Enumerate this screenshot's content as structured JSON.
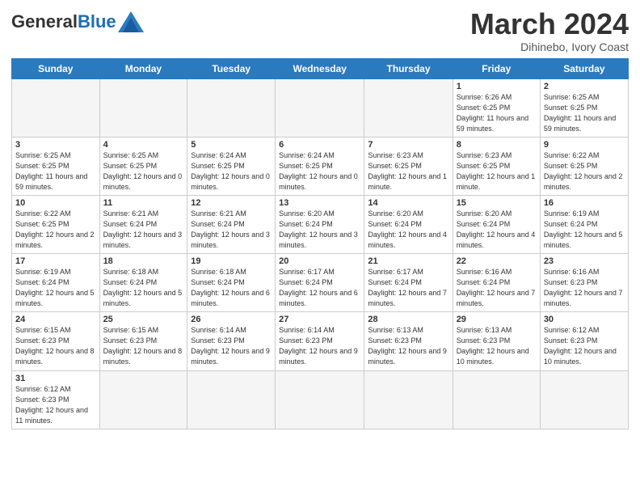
{
  "logo": {
    "text_general": "General",
    "text_blue": "Blue"
  },
  "header": {
    "month_year": "March 2024",
    "location": "Dihinebo, Ivory Coast"
  },
  "days_of_week": [
    "Sunday",
    "Monday",
    "Tuesday",
    "Wednesday",
    "Thursday",
    "Friday",
    "Saturday"
  ],
  "weeks": [
    [
      {
        "day": "",
        "info": ""
      },
      {
        "day": "",
        "info": ""
      },
      {
        "day": "",
        "info": ""
      },
      {
        "day": "",
        "info": ""
      },
      {
        "day": "",
        "info": ""
      },
      {
        "day": "1",
        "info": "Sunrise: 6:26 AM\nSunset: 6:25 PM\nDaylight: 11 hours and 59 minutes."
      },
      {
        "day": "2",
        "info": "Sunrise: 6:25 AM\nSunset: 6:25 PM\nDaylight: 11 hours and 59 minutes."
      }
    ],
    [
      {
        "day": "3",
        "info": "Sunrise: 6:25 AM\nSunset: 6:25 PM\nDaylight: 11 hours and 59 minutes."
      },
      {
        "day": "4",
        "info": "Sunrise: 6:25 AM\nSunset: 6:25 PM\nDaylight: 12 hours and 0 minutes."
      },
      {
        "day": "5",
        "info": "Sunrise: 6:24 AM\nSunset: 6:25 PM\nDaylight: 12 hours and 0 minutes."
      },
      {
        "day": "6",
        "info": "Sunrise: 6:24 AM\nSunset: 6:25 PM\nDaylight: 12 hours and 0 minutes."
      },
      {
        "day": "7",
        "info": "Sunrise: 6:23 AM\nSunset: 6:25 PM\nDaylight: 12 hours and 1 minute."
      },
      {
        "day": "8",
        "info": "Sunrise: 6:23 AM\nSunset: 6:25 PM\nDaylight: 12 hours and 1 minute."
      },
      {
        "day": "9",
        "info": "Sunrise: 6:22 AM\nSunset: 6:25 PM\nDaylight: 12 hours and 2 minutes."
      }
    ],
    [
      {
        "day": "10",
        "info": "Sunrise: 6:22 AM\nSunset: 6:25 PM\nDaylight: 12 hours and 2 minutes."
      },
      {
        "day": "11",
        "info": "Sunrise: 6:21 AM\nSunset: 6:24 PM\nDaylight: 12 hours and 3 minutes."
      },
      {
        "day": "12",
        "info": "Sunrise: 6:21 AM\nSunset: 6:24 PM\nDaylight: 12 hours and 3 minutes."
      },
      {
        "day": "13",
        "info": "Sunrise: 6:20 AM\nSunset: 6:24 PM\nDaylight: 12 hours and 3 minutes."
      },
      {
        "day": "14",
        "info": "Sunrise: 6:20 AM\nSunset: 6:24 PM\nDaylight: 12 hours and 4 minutes."
      },
      {
        "day": "15",
        "info": "Sunrise: 6:20 AM\nSunset: 6:24 PM\nDaylight: 12 hours and 4 minutes."
      },
      {
        "day": "16",
        "info": "Sunrise: 6:19 AM\nSunset: 6:24 PM\nDaylight: 12 hours and 5 minutes."
      }
    ],
    [
      {
        "day": "17",
        "info": "Sunrise: 6:19 AM\nSunset: 6:24 PM\nDaylight: 12 hours and 5 minutes."
      },
      {
        "day": "18",
        "info": "Sunrise: 6:18 AM\nSunset: 6:24 PM\nDaylight: 12 hours and 5 minutes."
      },
      {
        "day": "19",
        "info": "Sunrise: 6:18 AM\nSunset: 6:24 PM\nDaylight: 12 hours and 6 minutes."
      },
      {
        "day": "20",
        "info": "Sunrise: 6:17 AM\nSunset: 6:24 PM\nDaylight: 12 hours and 6 minutes."
      },
      {
        "day": "21",
        "info": "Sunrise: 6:17 AM\nSunset: 6:24 PM\nDaylight: 12 hours and 7 minutes."
      },
      {
        "day": "22",
        "info": "Sunrise: 6:16 AM\nSunset: 6:24 PM\nDaylight: 12 hours and 7 minutes."
      },
      {
        "day": "23",
        "info": "Sunrise: 6:16 AM\nSunset: 6:23 PM\nDaylight: 12 hours and 7 minutes."
      }
    ],
    [
      {
        "day": "24",
        "info": "Sunrise: 6:15 AM\nSunset: 6:23 PM\nDaylight: 12 hours and 8 minutes."
      },
      {
        "day": "25",
        "info": "Sunrise: 6:15 AM\nSunset: 6:23 PM\nDaylight: 12 hours and 8 minutes."
      },
      {
        "day": "26",
        "info": "Sunrise: 6:14 AM\nSunset: 6:23 PM\nDaylight: 12 hours and 9 minutes."
      },
      {
        "day": "27",
        "info": "Sunrise: 6:14 AM\nSunset: 6:23 PM\nDaylight: 12 hours and 9 minutes."
      },
      {
        "day": "28",
        "info": "Sunrise: 6:13 AM\nSunset: 6:23 PM\nDaylight: 12 hours and 9 minutes."
      },
      {
        "day": "29",
        "info": "Sunrise: 6:13 AM\nSunset: 6:23 PM\nDaylight: 12 hours and 10 minutes."
      },
      {
        "day": "30",
        "info": "Sunrise: 6:12 AM\nSunset: 6:23 PM\nDaylight: 12 hours and 10 minutes."
      }
    ],
    [
      {
        "day": "31",
        "info": "Sunrise: 6:12 AM\nSunset: 6:23 PM\nDaylight: 12 hours and 11 minutes."
      },
      {
        "day": "",
        "info": ""
      },
      {
        "day": "",
        "info": ""
      },
      {
        "day": "",
        "info": ""
      },
      {
        "day": "",
        "info": ""
      },
      {
        "day": "",
        "info": ""
      },
      {
        "day": "",
        "info": ""
      }
    ]
  ]
}
